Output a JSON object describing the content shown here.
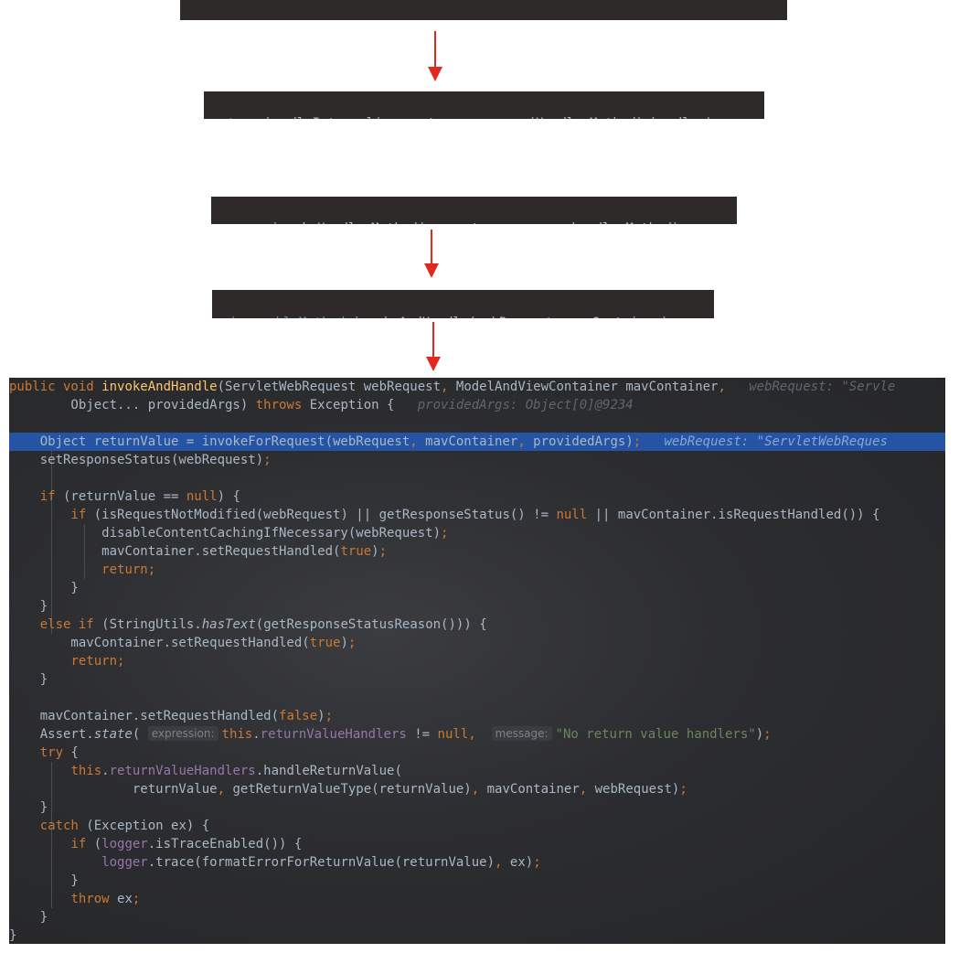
{
  "snippet1": {
    "code": "mv = ha.handle(processedRequest, response, mappedHandler.getHandler());"
  },
  "snippet2": {
    "code": "return handleInternal(request, response, (HandlerMethod) handler);"
  },
  "snippet3": {
    "code": "mav = invokeHandlerMethod(request, response, handlerMethod);"
  },
  "snippet4": {
    "code": "invocableMethod.invokeAndHandle(webRequest, mavContainer);"
  },
  "arrows": {
    "color": "#e2291f"
  },
  "editor": {
    "hints": {
      "web_request_sig": "webRequest: \"Servle",
      "provided_args": "providedArgs: Object[0]@9234",
      "web_request_line": "webRequest: \"ServletWebReques",
      "expression_label": "expression:",
      "message_label": "message:"
    },
    "strings": {
      "no_handlers": "\"No return value handlers\""
    },
    "highlight_color": "#2454a3"
  }
}
